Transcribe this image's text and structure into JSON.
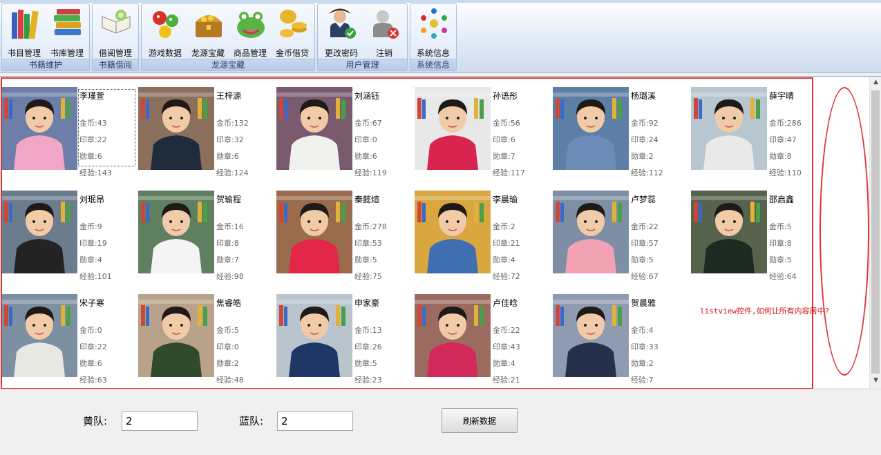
{
  "ribbon": {
    "groups": [
      {
        "title": "书籍维护",
        "buttons": [
          "书目管理",
          "书库管理"
        ]
      },
      {
        "title": "书籍借阅",
        "buttons": [
          "借阅管理"
        ]
      },
      {
        "title": "龙源宝藏",
        "buttons": [
          "游戏数据",
          "龙源宝藏",
          "商品管理",
          "金币借贷"
        ]
      },
      {
        "title": "用户管理",
        "buttons": [
          "更改密码",
          "注销"
        ]
      },
      {
        "title": "系统信息",
        "buttons": [
          "系统信息"
        ]
      }
    ]
  },
  "students": [
    {
      "name": "李瑾萱",
      "coins": "金币:43",
      "seals": "印章:22",
      "medals": "勋章:6",
      "exp": "经验:143"
    },
    {
      "name": "王梓源",
      "coins": "金币:132",
      "seals": "印章:32",
      "medals": "勋章:6",
      "exp": "经验:124"
    },
    {
      "name": "刘涵钰",
      "coins": "金币:67",
      "seals": "印章:0",
      "medals": "勋章:6",
      "exp": "经验:119"
    },
    {
      "name": "孙语彤",
      "coins": "金币:56",
      "seals": "印章:6",
      "medals": "勋章:7",
      "exp": "经验:117"
    },
    {
      "name": "杨璐溪",
      "coins": "金币:92",
      "seals": "印章:24",
      "medals": "勋章:2",
      "exp": "经验:112"
    },
    {
      "name": "薛宇晴",
      "coins": "金币:286",
      "seals": "印章:47",
      "medals": "勋章:8",
      "exp": "经验:110"
    },
    {
      "name": "刘珉昂",
      "coins": "金币:9",
      "seals": "印章:19",
      "medals": "勋章:4",
      "exp": "经验:101"
    },
    {
      "name": "贺瑜程",
      "coins": "金币:16",
      "seals": "印章:8",
      "medals": "勋章:7",
      "exp": "经验:98"
    },
    {
      "name": "秦懿煊",
      "coins": "金币:278",
      "seals": "印章:53",
      "medals": "勋章:5",
      "exp": "经验:75"
    },
    {
      "name": "李晨瑜",
      "coins": "金币:2",
      "seals": "印章:21",
      "medals": "勋章:4",
      "exp": "经验:72"
    },
    {
      "name": "卢梦蕊",
      "coins": "金币:22",
      "seals": "印章:57",
      "medals": "勋章:5",
      "exp": "经验:67"
    },
    {
      "name": "邵启鑫",
      "coins": "金币:5",
      "seals": "印章:8",
      "medals": "勋章:5",
      "exp": "经验:64"
    },
    {
      "name": "宋子寒",
      "coins": "金币:0",
      "seals": "印章:22",
      "medals": "勋章:6",
      "exp": "经验:63"
    },
    {
      "name": "焦睿皓",
      "coins": "金币:5",
      "seals": "印章:0",
      "medals": "勋章:2",
      "exp": "经验:48"
    },
    {
      "name": "申家豪",
      "coins": "金币:13",
      "seals": "印章:26",
      "medals": "勋章:5",
      "exp": "经验:23"
    },
    {
      "name": "卢佳晗",
      "coins": "金币:22",
      "seals": "印章:43",
      "medals": "勋章:4",
      "exp": "经验:21"
    },
    {
      "name": "贺晨雅",
      "coins": "金币:4",
      "seals": "印章:33",
      "medals": "勋章:2",
      "exp": "经验:7"
    }
  ],
  "annotation": "listview控件,如何让所有内容居中?",
  "bottom": {
    "yellow_label": "黄队:",
    "yellow_value": "2",
    "blue_label": "蓝队:",
    "blue_value": "2",
    "refresh_label": "刷新数据"
  },
  "photo_colors": [
    {
      "bg": "#6d7fa8",
      "shirt": "#f2a6c8"
    },
    {
      "bg": "#8a6f5c",
      "shirt": "#1f2a3a"
    },
    {
      "bg": "#7a5b6e",
      "shirt": "#f1f1ee"
    },
    {
      "bg": "#e8e8e8",
      "shirt": "#d8244f"
    },
    {
      "bg": "#5e7fa5",
      "shirt": "#6d8db8"
    },
    {
      "bg": "#b7c6cf",
      "shirt": "#e9e9e9"
    },
    {
      "bg": "#6c7c8f",
      "shirt": "#232323"
    },
    {
      "bg": "#5f7f60",
      "shirt": "#f4f4f4"
    },
    {
      "bg": "#9a6b4c",
      "shirt": "#e3264a"
    },
    {
      "bg": "#d9a640",
      "shirt": "#3f6fb0"
    },
    {
      "bg": "#7e8fa5",
      "shirt": "#f1a2b3"
    },
    {
      "bg": "#55624c",
      "shirt": "#1d2a22"
    },
    {
      "bg": "#7d8fa2",
      "shirt": "#e8e8e2"
    },
    {
      "bg": "#b8a28a",
      "shirt": "#2f4b2c"
    },
    {
      "bg": "#b9c4cc",
      "shirt": "#1f3766"
    },
    {
      "bg": "#9c6b5f",
      "shirt": "#d22a5a"
    },
    {
      "bg": "#8f9bb0",
      "shirt": "#26304a"
    }
  ]
}
